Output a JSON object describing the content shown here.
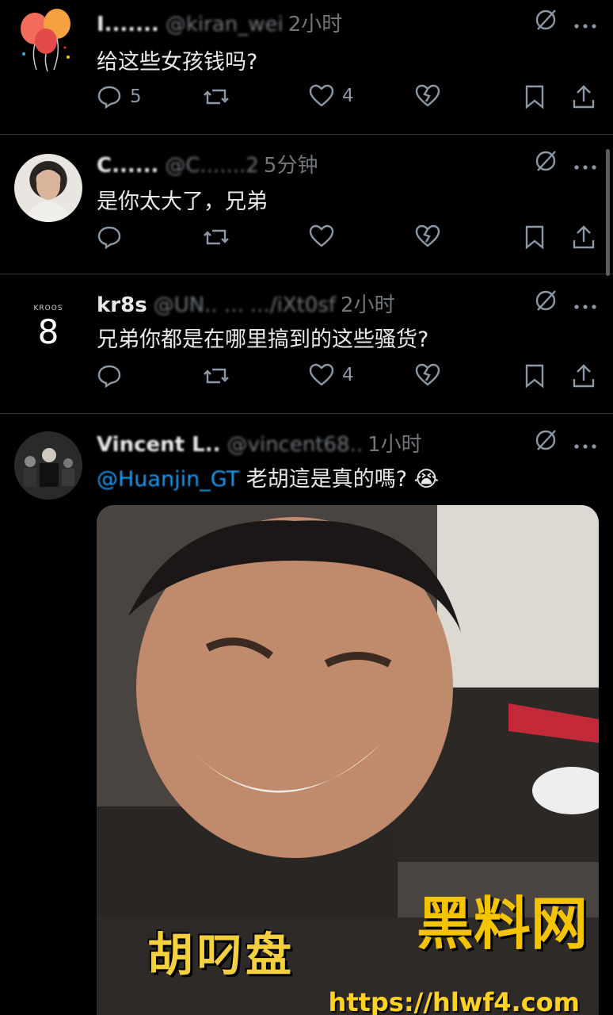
{
  "posts": [
    {
      "name": "I.......",
      "handle": "@kiran_wei",
      "time": "2小时",
      "text": "给这些女孩钱吗?",
      "avatar": "balloons",
      "replies": "5",
      "likes": "4"
    },
    {
      "name": "C......",
      "handle": "@C.......2",
      "time": "5分钟",
      "text": "是你太大了，兄弟",
      "avatar": "photo-man",
      "replies": "",
      "likes": ""
    },
    {
      "name": "kr8s",
      "handle": "@UN.. ... .../iXt0sf",
      "time": "2小时",
      "text": "兄弟你都是在哪里搞到的这些骚货?",
      "avatar": "kroos-8",
      "avatar_label_top": "KROOS",
      "avatar_label_num": "8",
      "replies": "",
      "likes": "4"
    },
    {
      "name": "Vincent L..",
      "handle": "@vincent68..",
      "time": "1小时",
      "mention": "@Huanjin_GT",
      "text": "老胡這是真的嗎?",
      "emoji": "😭",
      "avatar": "photo-group",
      "media_caption": "胡叼盘",
      "watermark": "黑料网",
      "watermark_url": "https://hlwf4.com"
    }
  ],
  "icons": {
    "more": "more-dots-icon",
    "grok": "grok-slash-icon",
    "reply": "reply-bubble-icon",
    "repost": "repost-arrows-icon",
    "like": "heart-icon",
    "heartbreak": "heartbreak-icon",
    "bookmark": "bookmark-icon",
    "share": "share-upload-icon"
  },
  "colors": {
    "background": "#000000",
    "text": "#e7e9ea",
    "muted": "#71767b",
    "link": "#1d9bf0",
    "watermark": "#f5c400"
  }
}
